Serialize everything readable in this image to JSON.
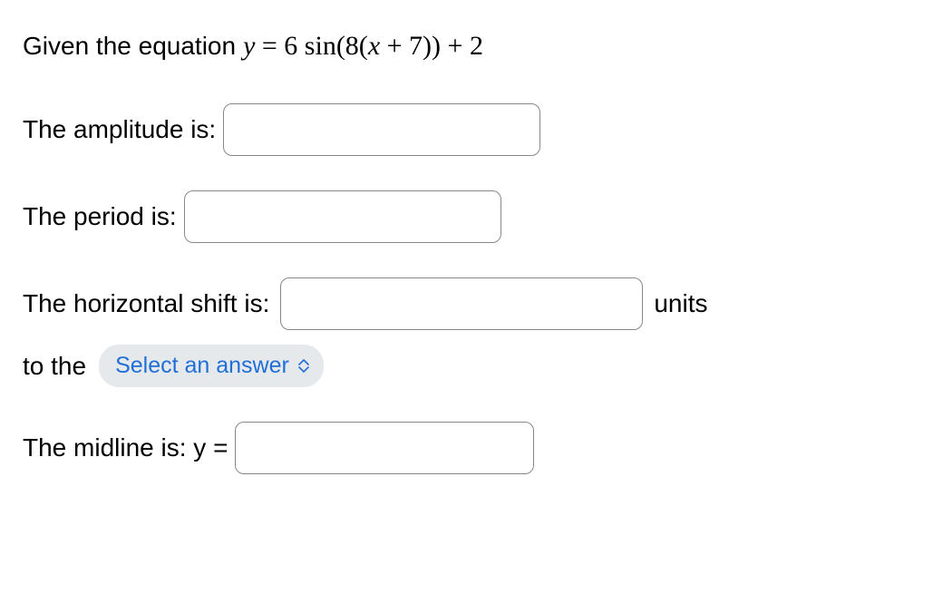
{
  "intro_prefix": "Given the equation ",
  "equation_text": "y = 6 sin(8(x + 7)) + 2",
  "amplitude_label": "The amplitude is:",
  "period_label": "The period is:",
  "hshift_label": "The horizontal shift is:",
  "hshift_suffix": "units",
  "hshift_to_the": "to the",
  "select_placeholder": "Select an answer",
  "midline_label": "The midline is: y =",
  "inputs": {
    "amplitude": "",
    "period": "",
    "hshift": "",
    "midline": ""
  }
}
